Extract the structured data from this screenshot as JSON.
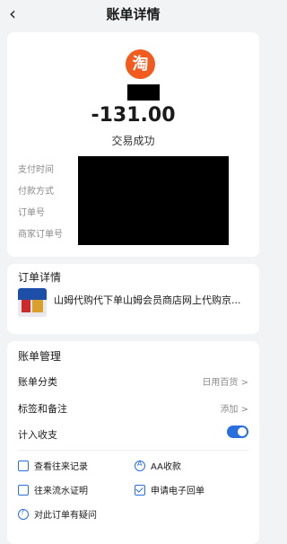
{
  "nav": {
    "back_icon": "chevron-left-icon",
    "title": "账单详情"
  },
  "summary": {
    "merchant_logo_text": "淘",
    "amount": "-131.00",
    "status": "交易成功",
    "fields": [
      "支付时间",
      "付款方式",
      "订单号",
      "商家订单号"
    ]
  },
  "order": {
    "title": "订单详情",
    "product_name": "山姆代购代下单山姆会员商店网上代购京..."
  },
  "manage": {
    "title": "账单管理",
    "category_label": "账单分类",
    "category_value": "日用百货 >",
    "tags_label": "标签和备注",
    "tags_value": "添加 >",
    "income_label": "计入收支",
    "income_enabled": true
  },
  "actions": {
    "view_history": "查看往来记录",
    "aa": "AA收款",
    "statement": "往来流水证明",
    "e_receipt": "申请电子回单",
    "question": "对此订单有疑问"
  },
  "colors": {
    "brand": "#f25a1e",
    "accent": "#2a6fe0"
  }
}
